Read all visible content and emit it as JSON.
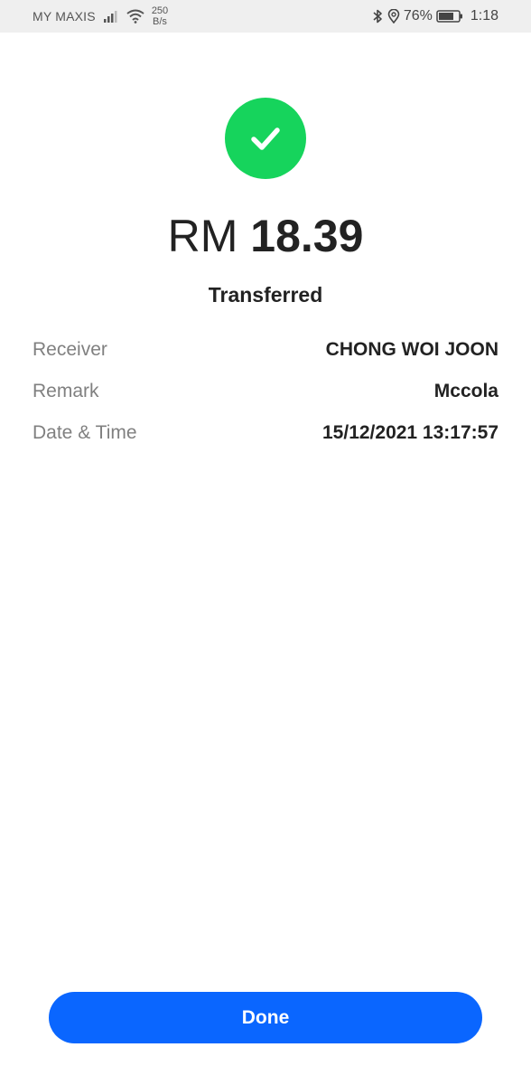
{
  "status_bar": {
    "carrier": "MY MAXIS",
    "net_speed_value": "250",
    "net_speed_unit": "B/s",
    "battery": "76%",
    "time": "1:18",
    "icons": [
      "signal-icon",
      "wifi-icon",
      "bluetooth-icon",
      "location-icon",
      "battery-icon"
    ]
  },
  "result": {
    "icon": "check-icon",
    "icon_color": "#16d45c",
    "currency": "RM",
    "amount": "18.39",
    "status": "Transferred"
  },
  "details": [
    {
      "label": "Receiver",
      "value": "CHONG WOI JOON"
    },
    {
      "label": "Remark",
      "value": "Mccola"
    },
    {
      "label": "Date & Time",
      "value": "15/12/2021 13:17:57"
    }
  ],
  "actions": {
    "done_label": "Done",
    "done_color": "#0a66ff"
  }
}
